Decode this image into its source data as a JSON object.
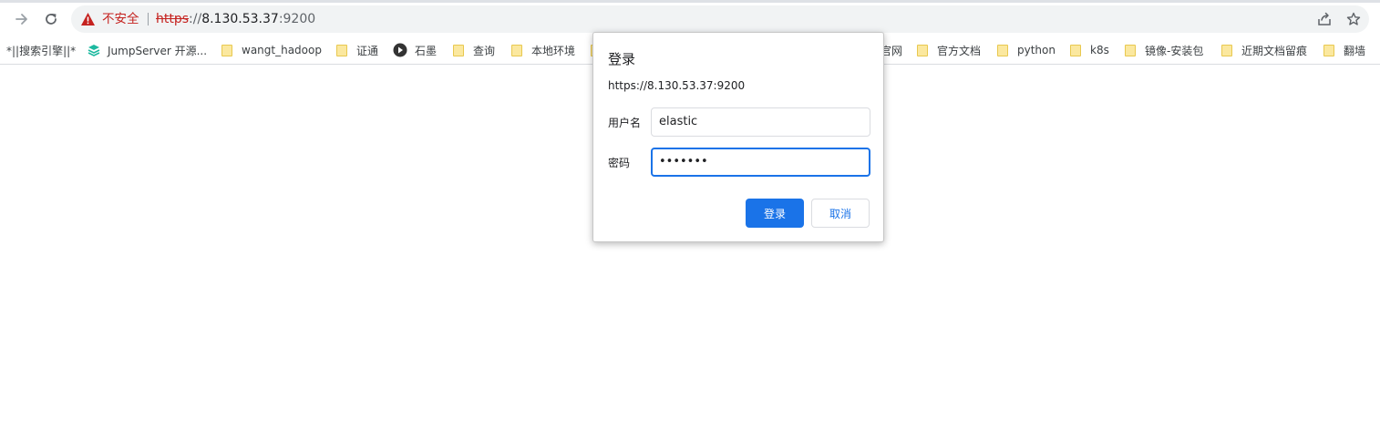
{
  "toolbar": {
    "forward_icon": "arrow-right-icon",
    "reload_icon": "reload-icon",
    "share_icon": "share-icon",
    "star_icon": "star-icon"
  },
  "omnibox": {
    "security_label": "不安全",
    "url_scheme": "https",
    "url_separator": "://",
    "url_host": "8.130.53.37",
    "url_port": ":9200",
    "warning_color": "#c5221f"
  },
  "bookmarks": [
    {
      "label": "*||搜索引擎||*",
      "icon": "none"
    },
    {
      "label": "JumpServer 开源...",
      "icon": "jumpserver-icon"
    },
    {
      "label": "wangt_hadoop",
      "icon": "folder-icon"
    },
    {
      "label": "证通",
      "icon": "folder-icon"
    },
    {
      "label": "石墨",
      "icon": "shimo-icon"
    },
    {
      "label": "查询",
      "icon": "folder-icon"
    },
    {
      "label": "本地环境",
      "icon": "folder-icon"
    },
    {
      "label": "官网",
      "icon": "folder-icon"
    },
    {
      "label": "官方文档",
      "icon": "folder-icon"
    },
    {
      "label": "python",
      "icon": "folder-icon"
    },
    {
      "label": "k8s",
      "icon": "folder-icon"
    },
    {
      "label": "镜像-安装包",
      "icon": "folder-icon"
    },
    {
      "label": "近期文档留痕",
      "icon": "folder-icon"
    },
    {
      "label": "翻墙",
      "icon": "folder-icon"
    }
  ],
  "dialog": {
    "title": "登录",
    "origin": "https://8.130.53.37:9200",
    "username_label": "用户名",
    "username_value": "elastic",
    "password_label": "密码",
    "password_value": "•••••••",
    "login_button": "登录",
    "cancel_button": "取消",
    "accent_color": "#1a73e8"
  }
}
